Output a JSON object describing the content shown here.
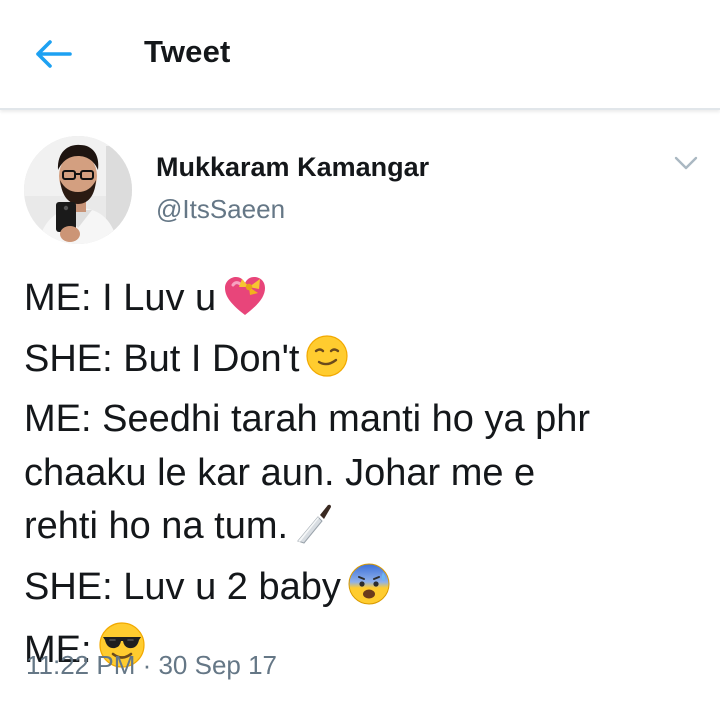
{
  "header": {
    "title": "Tweet",
    "back_icon": "arrow-left-icon",
    "accent_color": "#1da1f2"
  },
  "author": {
    "name": "Mukkaram Kamangar",
    "handle": "@ItsSaeen"
  },
  "menu_icon": "chevron-down-icon",
  "tweet": {
    "lines": [
      {
        "text": "ME: I Luv u",
        "emoji": "heart-with-ribbon-emoji"
      },
      {
        "text": "SHE: But I Don't",
        "emoji": "smiling-face-emoji"
      },
      {
        "text": "ME: Seedhi tarah manti ho ya phr",
        "emoji": ""
      },
      {
        "text": "chaaku le kar aun. Johar me e",
        "emoji": ""
      },
      {
        "text": "rehti ho na tum.",
        "emoji": "kitchen-knife-emoji"
      },
      {
        "text": "SHE: Luv u 2 baby",
        "emoji": "anxious-face-with-sweat-emoji"
      },
      {
        "text": "ME:",
        "emoji": "smiling-face-with-sunglasses-emoji"
      }
    ]
  },
  "timestamp": "11:22 PM · 30 Sep 17"
}
